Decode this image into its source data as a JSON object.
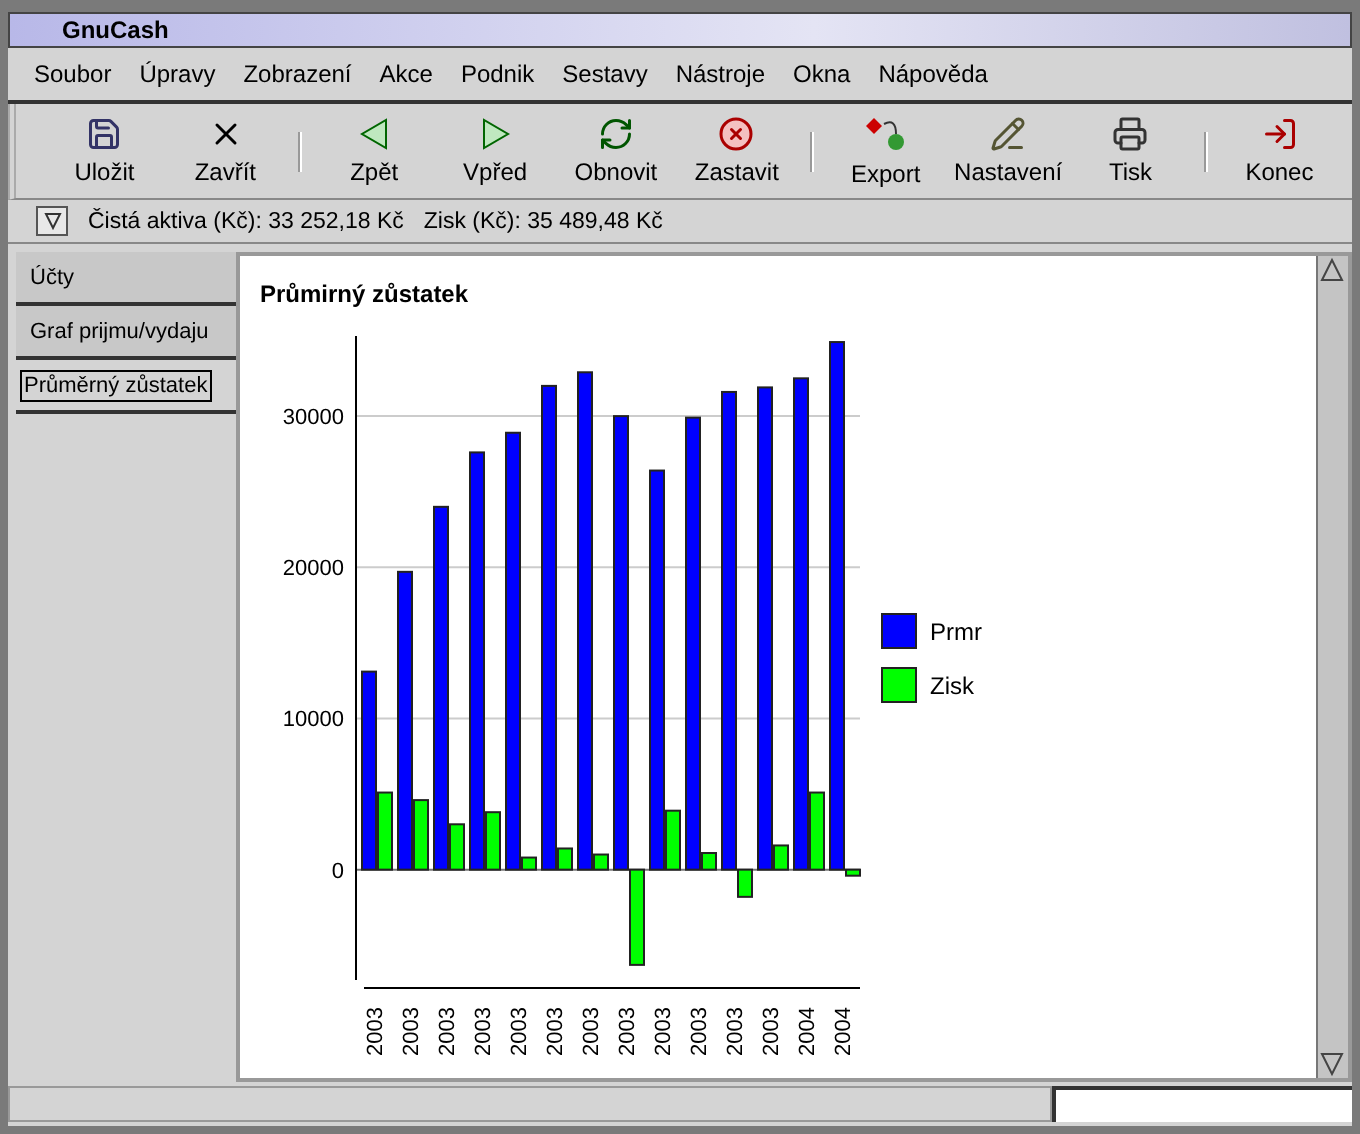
{
  "window": {
    "title": "GnuCash"
  },
  "menu": [
    "Soubor",
    "Úpravy",
    "Zobrazení",
    "Akce",
    "Podnik",
    "Sestavy",
    "Nástroje",
    "Okna",
    "Nápověda"
  ],
  "toolbar": [
    {
      "kind": "save",
      "label": "Uložit"
    },
    {
      "kind": "close",
      "label": "Zavřít"
    },
    {
      "kind": "sep"
    },
    {
      "kind": "back",
      "label": "Zpět"
    },
    {
      "kind": "forward",
      "label": "Vpřed"
    },
    {
      "kind": "refresh",
      "label": "Obnovit"
    },
    {
      "kind": "stop",
      "label": "Zastavit"
    },
    {
      "kind": "sep"
    },
    {
      "kind": "export",
      "label": "Export"
    },
    {
      "kind": "options",
      "label": "Nastavení"
    },
    {
      "kind": "print",
      "label": "Tisk"
    },
    {
      "kind": "sep"
    },
    {
      "kind": "quit",
      "label": "Konec"
    }
  ],
  "summary": [
    "Čistá aktiva (Kč): 33 252,18 Kč",
    "Zisk (Kč): 35 489,48 Kč"
  ],
  "tabs": [
    {
      "label": "Účty",
      "selected": false
    },
    {
      "label": "Graf prijmu/vydaju",
      "selected": false
    },
    {
      "label": "Průměrný zůstatek",
      "selected": true
    }
  ],
  "report": {
    "title": "Průmirný zůstatek",
    "chart_data": {
      "type": "bar",
      "categories": [
        "2003",
        "2003",
        "2003",
        "2003",
        "2003",
        "2003",
        "2003",
        "2003",
        "2003",
        "2003",
        "2003",
        "2003",
        "2004",
        "2004"
      ],
      "series": [
        {
          "name": "Prmr",
          "color": "#0000ff",
          "values": [
            13100,
            19700,
            24000,
            27600,
            28900,
            32000,
            32900,
            30000,
            26400,
            29900,
            31600,
            31900,
            32500,
            34900
          ]
        },
        {
          "name": "Zisk",
          "color": "#00ff00",
          "values": [
            5100,
            4600,
            3000,
            3800,
            800,
            1400,
            1000,
            -6300,
            3900,
            1100,
            -1800,
            1600,
            5100,
            -400
          ]
        }
      ],
      "ylim": [
        -7300,
        35300
      ],
      "grid": true,
      "legend": true,
      "yticks": [
        0,
        10000,
        20000,
        30000
      ]
    }
  }
}
